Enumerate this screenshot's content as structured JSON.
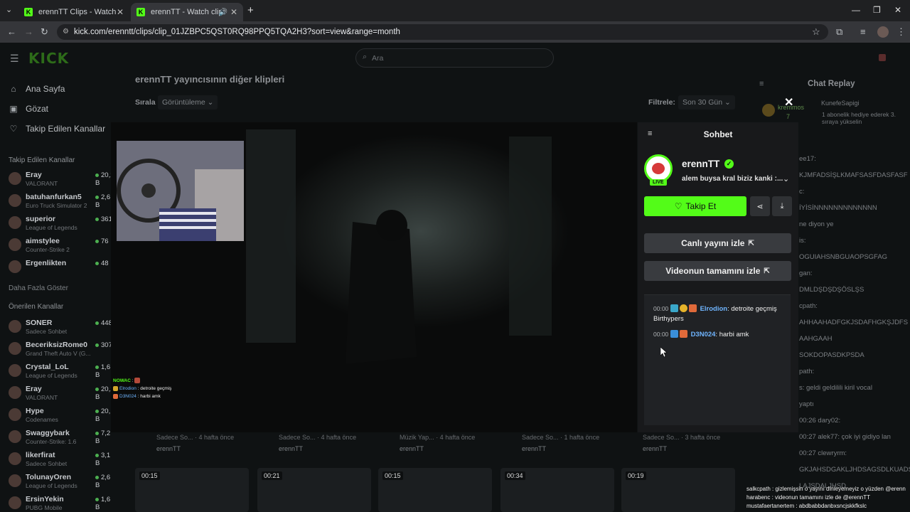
{
  "browser": {
    "tabs": [
      {
        "title": "erennTT Clips - Watch Live on K",
        "active": false
      },
      {
        "title": "erennTT - Watch clips on K",
        "active": true
      }
    ],
    "new_tab": "+",
    "url": "kick.com/erenntt/clips/clip_01JZBPC5QST0RQ98PPQ5TQA2H3?sort=view&range=month",
    "window_controls": [
      "—",
      "❐",
      "✕"
    ]
  },
  "site": {
    "logo": "KICK",
    "search_placeholder": "Ara"
  },
  "sidebar": {
    "nav": [
      {
        "label": "Ana Sayfa",
        "icon": "home-icon"
      },
      {
        "label": "Gözat",
        "icon": "browse-icon"
      },
      {
        "label": "Takip Edilen Kanallar",
        "icon": "heart-icon"
      }
    ],
    "followed_heading": "Takip Edilen Kanallar",
    "followed": [
      {
        "name": "Eray",
        "game": "VALORANT",
        "viewers": "20,2 B"
      },
      {
        "name": "batuhanfurkan5",
        "game": "Euro Truck Simulator 2",
        "viewers": "2,6 B"
      },
      {
        "name": "superior",
        "game": "League of Legends",
        "viewers": "361"
      },
      {
        "name": "aimstylee",
        "game": "Counter-Strike 2",
        "viewers": "76"
      },
      {
        "name": "Ergenlikten",
        "game": "",
        "viewers": "48"
      }
    ],
    "show_more": "Daha Fazla Göster",
    "recommended_heading": "Önerilen Kanallar",
    "recommended": [
      {
        "name": "SONER",
        "game": "Sadece Sohbet",
        "viewers": "448"
      },
      {
        "name": "BeceriksizRome0",
        "game": "Grand Theft Auto V (G...",
        "viewers": "307"
      },
      {
        "name": "Crystal_LoL",
        "game": "League of Legends",
        "viewers": "1,6 B"
      },
      {
        "name": "Eray",
        "game": "VALORANT",
        "viewers": "20,2 B"
      },
      {
        "name": "Hype",
        "game": "Codenames",
        "viewers": "20,1 B"
      },
      {
        "name": "Swaggybark",
        "game": "Counter-Strike: 1.6",
        "viewers": "7,2 B"
      },
      {
        "name": "likerfirat",
        "game": "Sadece Sohbet",
        "viewers": "3,1 B"
      },
      {
        "name": "TolunayOren",
        "game": "League of Legends",
        "viewers": "2,6 B"
      },
      {
        "name": "ErsinYekin",
        "game": "PUBG Mobile",
        "viewers": "1,6 B"
      }
    ]
  },
  "main": {
    "heading": "erennTT yayıncısının diğer klipleri",
    "sort_label": "Sırala",
    "sort_value": "Görüntüleme",
    "filter_label": "Filtrele:",
    "filter_value": "Son 30 Gün",
    "cards_row1": [
      {
        "meta": "Sadece So... · 4 hafta önce",
        "author": "erennTT"
      },
      {
        "meta": "Sadece So... · 4 hafta önce",
        "author": "erennTT"
      },
      {
        "meta": "Müzik Yap... · 4 hafta önce",
        "author": "erennTT"
      },
      {
        "meta": "Sadece So... · 1 hafta önce",
        "author": "erennTT"
      },
      {
        "meta": "Sadece So... · 3 hafta önce",
        "author": "erennTT"
      }
    ],
    "cards_row2_durations": [
      "00:15",
      "00:21",
      "00:15",
      "00:34",
      "00:19"
    ]
  },
  "chat_replay": {
    "title": "Chat Replay",
    "pinned_user": "kremmos",
    "pinned_count": "7",
    "gift_user": "KunefeSapigi",
    "gift_text": "1 abonelik hediye ederek 3. sıraya yükselin",
    "lines": [
      "ee17:",
      "KJMFADSİŞLKMAFSASFDASFASF",
      "c:",
      "İYİSİNNNNNNNNNNNNN",
      "ne diyon ye",
      "is:",
      "OGUIAHSNBGUAOPSGFAG",
      "gan:",
      "DMLDŞDŞDŞÖSLŞS",
      "cpath:",
      "AHHAAHADFGKJSDAFHGKŞJDFS",
      "AAHGAAH",
      "SOKDOPASDKPSDA",
      "path:",
      "s: geldi geldilili kiril vocal",
      "yaptı",
      "00:26 dary02:",
      "00:27 alek77: çok iyi gidiyo lan",
      "00:27 clewryrm:",
      "GKJAHSDGAKLJHDSAGSDLKUADSGVLAABDK",
      "LAJSDALJHSD"
    ],
    "bottom_lines": [
      "salkcpath : gizlemişsin o yayını dinleyemeyiz o yüzden @erenn",
      "harabenc : videonun tamamını izle de @erennTT",
      "mustafaertanertem : abdbabbdanbxsncjskkfkslc"
    ]
  },
  "modal": {
    "panel_title": "Sohbet",
    "streamer_name": "erennTT",
    "live_badge": "LIVE",
    "stream_title": "alem buysa kral biziz kanki :...",
    "follow_label": "Takip Et",
    "watch_live_label": "Canlı yayını izle",
    "watch_full_label": "Videonun tamamını izle",
    "chat": [
      {
        "time": "00:00",
        "user": "Elrodion",
        "message": "detroite geçmiş Birthypers"
      },
      {
        "time": "00:00",
        "user": "D3N024",
        "message": "harbi amk"
      }
    ],
    "overlay_chat": [
      {
        "user": "NOWAC",
        "message": ""
      },
      {
        "user": "Elrodion",
        "message": "detroite geçmiş"
      },
      {
        "user": "D3N024",
        "message": "harbi amk"
      }
    ]
  },
  "colors": {
    "kick_green": "#53fc18",
    "link_blue": "#6fb5ff"
  }
}
